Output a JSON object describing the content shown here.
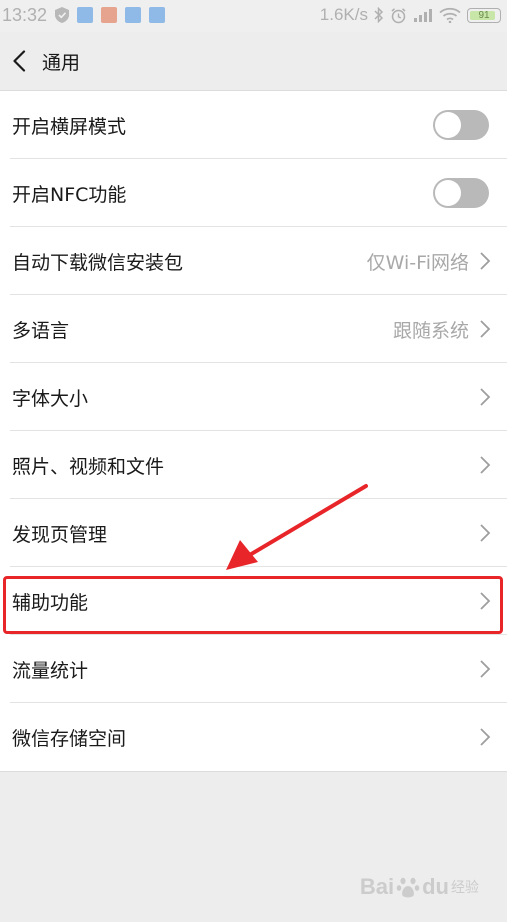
{
  "status_bar": {
    "time": "13:32",
    "network_speed": "1.6K/s",
    "battery_level": "91",
    "battery_percent": 91,
    "notification_icons": [
      "shield-icon",
      "app-notification-icon",
      "app-notification-icon",
      "app-notification-icon",
      "app-notification-icon"
    ],
    "notification_colors": [
      "#8fb9e6",
      "#e6a48f",
      "#8fb9e6",
      "#8fb9e6"
    ]
  },
  "header": {
    "title": "通用",
    "back_icon": "chevron-left-icon"
  },
  "settings": {
    "items": [
      {
        "label": "开启横屏模式",
        "type": "toggle",
        "on": false
      },
      {
        "label": "开启NFC功能",
        "type": "toggle",
        "on": false
      },
      {
        "label": "自动下载微信安装包",
        "type": "link",
        "value": "仅Wi-Fi网络"
      },
      {
        "label": "多语言",
        "type": "link",
        "value": "跟随系统"
      },
      {
        "label": "字体大小",
        "type": "link",
        "value": ""
      },
      {
        "label": "照片、视频和文件",
        "type": "link",
        "value": ""
      },
      {
        "label": "发现页管理",
        "type": "link",
        "value": ""
      },
      {
        "label": "辅助功能",
        "type": "link",
        "value": "",
        "highlighted": true
      },
      {
        "label": "流量统计",
        "type": "link",
        "value": ""
      },
      {
        "label": "微信存储空间",
        "type": "link",
        "value": ""
      }
    ]
  },
  "annotation": {
    "color": "#e8262a",
    "target": "辅助功能"
  },
  "watermark": {
    "brand": "Bai",
    "brand_suffix": "du",
    "sub": "经验"
  },
  "colors": {
    "background": "#ededed",
    "card": "#ffffff",
    "toggle_off": "#b9b9b9",
    "secondary_text": "#a8a8a8"
  }
}
